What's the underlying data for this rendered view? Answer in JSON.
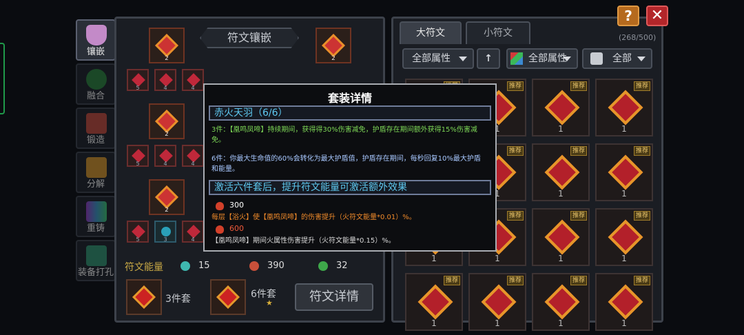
{
  "side_menu": [
    {
      "label": "镶嵌",
      "icon": "flask-icon",
      "active": true
    },
    {
      "label": "融合",
      "icon": "fusion-icon",
      "active": false
    },
    {
      "label": "锻造",
      "icon": "anvil-icon",
      "active": false
    },
    {
      "label": "分解",
      "icon": "decompose-icon",
      "active": false
    },
    {
      "label": "重铸",
      "icon": "recast-icon",
      "active": false
    },
    {
      "label": "装备打孔",
      "icon": "drill-icon",
      "active": false
    }
  ],
  "left_panel": {
    "title": "符文镶嵌",
    "slot_numbers_top": [
      "5",
      "4",
      "4"
    ],
    "slot_numbers_mid": [
      "5",
      "4",
      "4"
    ],
    "slot_numbers_bottom": [
      "5",
      "3",
      "4"
    ],
    "big_slot_numbers": [
      "2",
      "2",
      "2",
      "2"
    ],
    "energy_label": "符文能量",
    "energy": [
      {
        "icon": "teal-gem-icon",
        "value": "15",
        "color": "#3fb8b0"
      },
      {
        "icon": "fire-gem-icon",
        "value": "390",
        "color": "#c8503a"
      },
      {
        "icon": "green-gem-icon",
        "value": "32",
        "color": "#3ea84a"
      }
    ],
    "set_3_label": "3件套",
    "set_6_label": "6件套",
    "star": "★",
    "detail_button": "符文详情"
  },
  "right_panel": {
    "tabs": [
      {
        "label": "大符文",
        "active": true
      },
      {
        "label": "小符文",
        "active": false
      }
    ],
    "count": "(268/500)",
    "filters": {
      "attr_label": "全部属性",
      "arrow": "↑",
      "attr2_label": "全部属性",
      "type_label": "全部"
    },
    "recommend_tag": "推荐",
    "grid_number": "1"
  },
  "buttons": {
    "help": "?",
    "close": "✕"
  },
  "modal": {
    "title": "套装详情",
    "set_header": "赤火天羽（6/6）",
    "piece3": "3件：【凰鸣凤啼】持续期间，获得得30%伤害减免，护盾存在期间额外获得15%伤害减免。",
    "piece6": "6件：你最大生命值的60%会转化为最大护盾值，护盾存在期间，每秒回复10%最大护盾和能量。",
    "activate_header": "激活六件套后，提升符文能量可激活额外效果",
    "bonus1_value": "300",
    "bonus1_text": "每层【浴火】使【凰鸣凤啼】的伤害提升（火符文能量*0.01）%。",
    "bonus2_value": "600",
    "bonus2_text": "【凰鸣凤啼】期间火属性伤害提升（火符文能量*0.15）%。",
    "green": "#7ed957",
    "blue": "#a8c8ff",
    "orange": "#f08a2a"
  }
}
